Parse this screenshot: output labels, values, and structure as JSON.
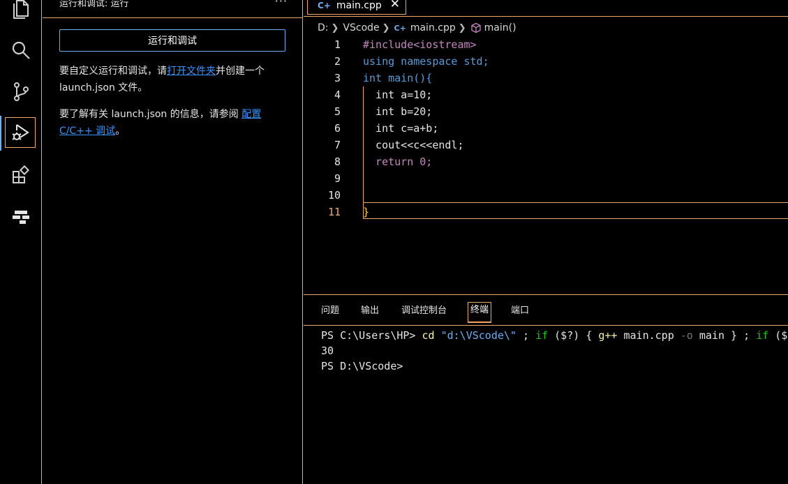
{
  "activity_bar": {
    "items": [
      {
        "icon": "files-icon",
        "active": false
      },
      {
        "icon": "search-icon",
        "active": false
      },
      {
        "icon": "source-control-icon",
        "active": false
      },
      {
        "icon": "run-debug-icon",
        "active": true
      },
      {
        "icon": "extensions-icon",
        "active": false
      },
      {
        "icon": "remote-explorer-icon",
        "active": false
      }
    ],
    "accent": "#f0a868",
    "indicator_color": "#6ab0f3"
  },
  "sidebar": {
    "title": "运行和调试: 运行",
    "more": "···",
    "run_button": "运行和调试",
    "para1_before": "要自定义运行和调试，请",
    "para1_link": "打开文件夹",
    "para1_after": "并创建一个 launch.json 文件。",
    "para2_before": "要了解有关 launch.json 的信息，请参阅 ",
    "para2_link": "配置 C/C++ 调试",
    "para2_after": "。"
  },
  "tabs": [
    {
      "label": "main.cpp",
      "icon": "cpp-file-icon",
      "close": "✕"
    }
  ],
  "breadcrumb": {
    "drive": "D:",
    "folder": "VScode",
    "file": "main.cpp",
    "symbol": "main()"
  },
  "editor": {
    "line_numbers": [
      "1",
      "2",
      "3",
      "4",
      "5",
      "6",
      "7",
      "8",
      "9",
      "10",
      "11"
    ],
    "current_line": "11",
    "lines": [
      "#include<iostream>",
      "using namespace std;",
      "int main(){",
      "  int a=10;",
      "  int b=20;",
      "  int c=a+b;",
      "  cout<<c<<endl;",
      "  return 0;",
      "",
      "",
      "}"
    ]
  },
  "panel": {
    "tabs": [
      "问题",
      "输出",
      "调试控制台",
      "终端",
      "端口"
    ],
    "active_tab": "终端",
    "terminal": {
      "line1_prompt": "PS C:\\Users\\HP> ",
      "line1_cd": "cd",
      "line1_path": "\"d:\\VScode\\\"",
      "line1_semi1": " ; ",
      "line1_if1": "if",
      "line1_cond": " ($?) ",
      "line1_brace_open": "{ ",
      "line1_gpp": "g++",
      "line1_args": " main.cpp ",
      "line1_flag": "-o",
      "line1_out": " main } ; ",
      "line1_if2": "if",
      "line1_tail": " ($",
      "line2": "30",
      "line3": "PS D:\\VScode>"
    }
  }
}
